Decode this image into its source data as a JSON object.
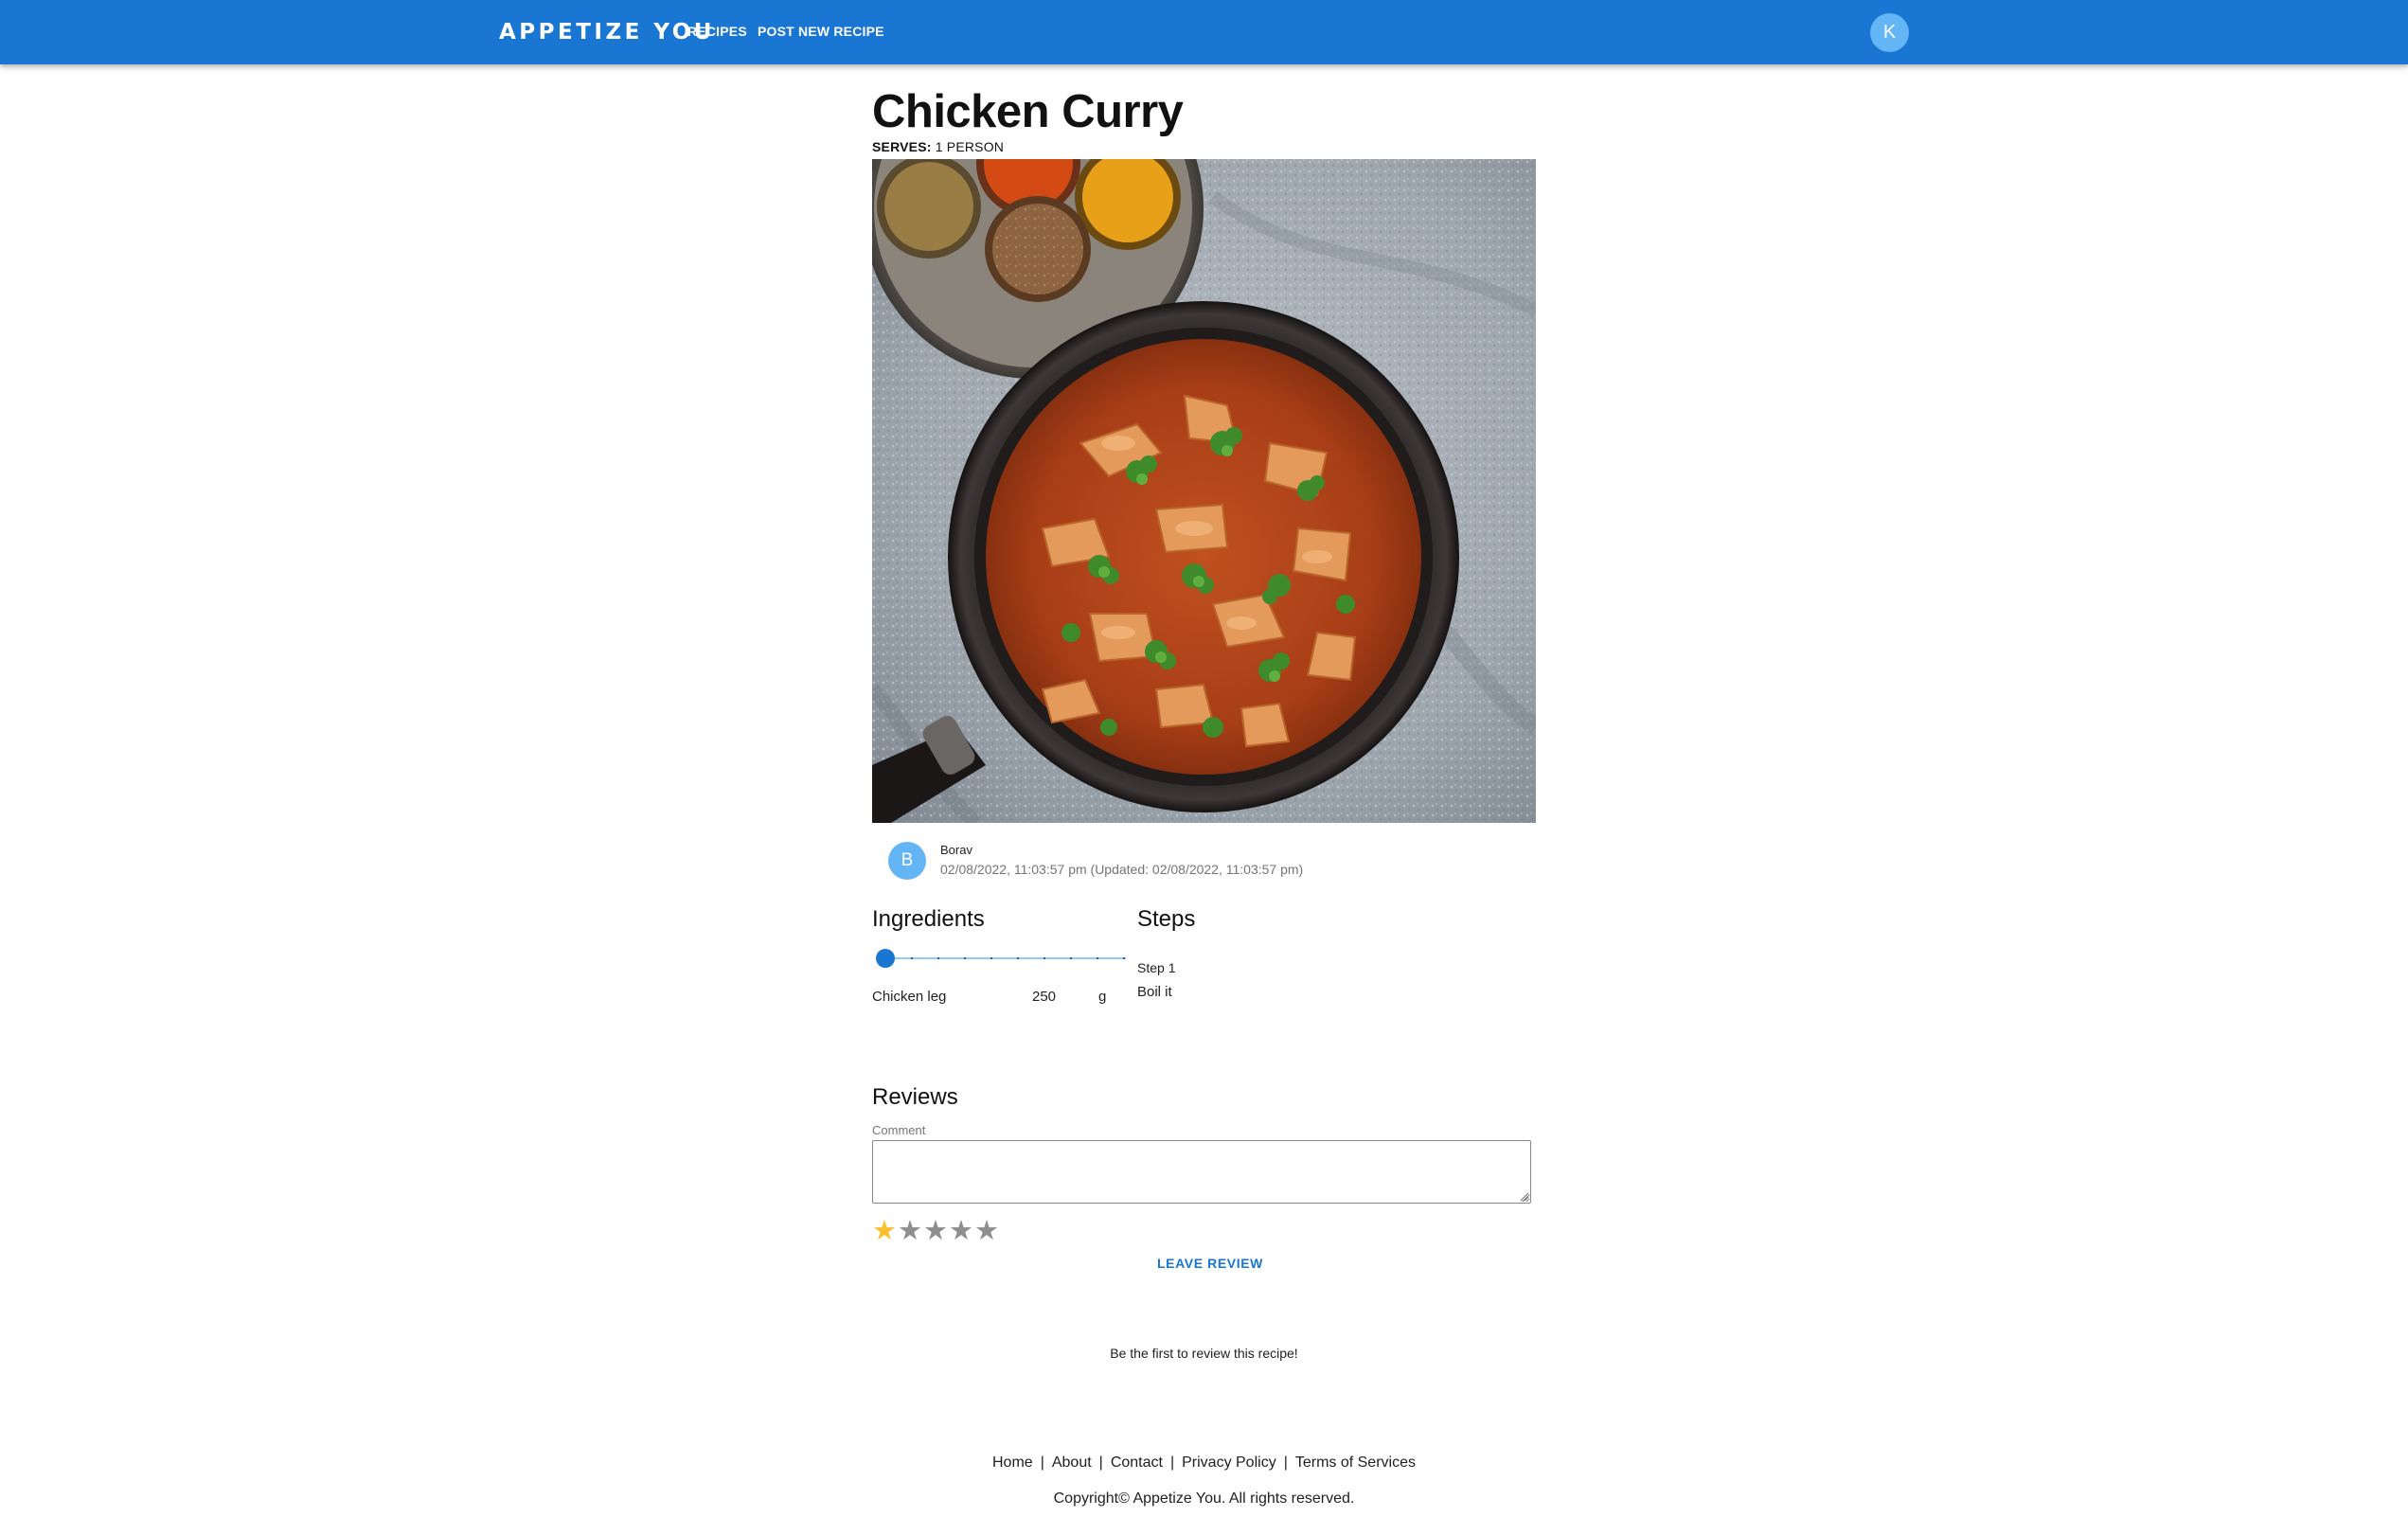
{
  "header": {
    "brand": "APPETIZE YOU",
    "nav": [
      {
        "label": "RECIPES"
      },
      {
        "label": "POST NEW RECIPE"
      }
    ],
    "user_initial": "K",
    "accent": "#1976d2"
  },
  "recipe": {
    "title": "Chicken Curry",
    "serves_label": "SERVES:",
    "serves_value": "1 PERSON",
    "author": {
      "initial": "B",
      "name": "Borav",
      "meta": "02/08/2022, 11:03:57 pm (Updated: 02/08/2022, 11:03:57 pm)"
    }
  },
  "ingredients": {
    "heading": "Ingredients",
    "servings_slider_level": 0,
    "items": [
      {
        "name": "Chicken leg",
        "quantity": "250",
        "unit": "g"
      }
    ]
  },
  "steps": {
    "heading": "Steps",
    "items": [
      {
        "label": "Step 1",
        "text": "Boil it"
      }
    ]
  },
  "reviews": {
    "heading": "Reviews",
    "comment_label": "Comment",
    "comment_value": "",
    "rating": 1,
    "max_rating": 5,
    "star_glyph": "★",
    "submit_label": "LEAVE REVIEW",
    "empty_message": "Be the first to review this recipe!"
  },
  "footer": {
    "links": [
      "Home",
      "About",
      "Contact",
      "Privacy Policy",
      "Terms of Services"
    ],
    "separator": "|",
    "copyright": "Copyright© Appetize You. All rights reserved."
  },
  "icons": {
    "user_avatar": "avatar",
    "author_avatar": "avatar",
    "rating": "star-icon",
    "textarea_resize": "resize-grip-icon"
  }
}
